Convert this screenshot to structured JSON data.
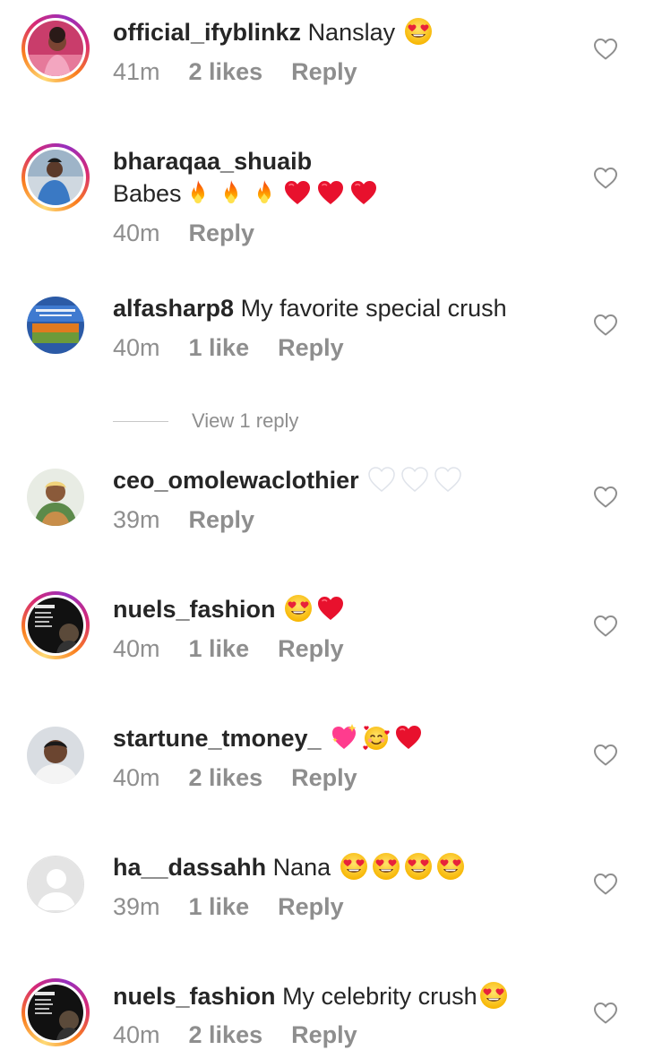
{
  "comments": [
    {
      "username": "official_ifyblinkz",
      "text": "Nanslay",
      "emojis": [
        "heart-eyes"
      ],
      "time": "41m",
      "likes": "2 likes",
      "reply": "Reply",
      "story_ring": true
    },
    {
      "username": "bharaqaa_shuaib",
      "text": "Babes",
      "emojis": [
        "fire",
        "fire",
        "fire",
        "red-heart",
        "red-heart",
        "red-heart"
      ],
      "time": "40m",
      "likes": "",
      "reply": "Reply",
      "story_ring": true
    },
    {
      "username": "alfasharp8",
      "text": "My favorite special crush",
      "emojis": [],
      "time": "40m",
      "likes": "1 like",
      "reply": "Reply",
      "story_ring": false
    },
    {
      "username": "ceo_omolewaclothier",
      "text": "",
      "emojis": [
        "white-heart",
        "white-heart",
        "white-heart"
      ],
      "time": "39m",
      "likes": "",
      "reply": "Reply",
      "story_ring": false
    },
    {
      "username": "nuels_fashion",
      "text": "",
      "emojis": [
        "heart-eyes",
        "red-heart"
      ],
      "time": "40m",
      "likes": "1 like",
      "reply": "Reply",
      "story_ring": true
    },
    {
      "username": "startune_tmoney_",
      "text": "",
      "emojis": [
        "sparkling-heart",
        "smiling-hearts",
        "red-heart"
      ],
      "time": "40m",
      "likes": "2 likes",
      "reply": "Reply",
      "story_ring": false
    },
    {
      "username": "ha__dassahh",
      "text": "Nana",
      "emojis": [
        "heart-eyes",
        "heart-eyes",
        "heart-eyes",
        "heart-eyes"
      ],
      "time": "39m",
      "likes": "1 like",
      "reply": "Reply",
      "story_ring": false
    },
    {
      "username": "nuels_fashion",
      "text": "My celebrity crush",
      "emojis": [
        "heart-eyes"
      ],
      "time": "40m",
      "likes": "2 likes",
      "reply": "Reply",
      "story_ring": true
    }
  ],
  "view_replies": "View 1 reply",
  "colors": {
    "text": "#262626",
    "muted": "#8e8e8e",
    "divider": "#c7c7c7"
  },
  "icons": {
    "like": "heart-outline-icon"
  }
}
